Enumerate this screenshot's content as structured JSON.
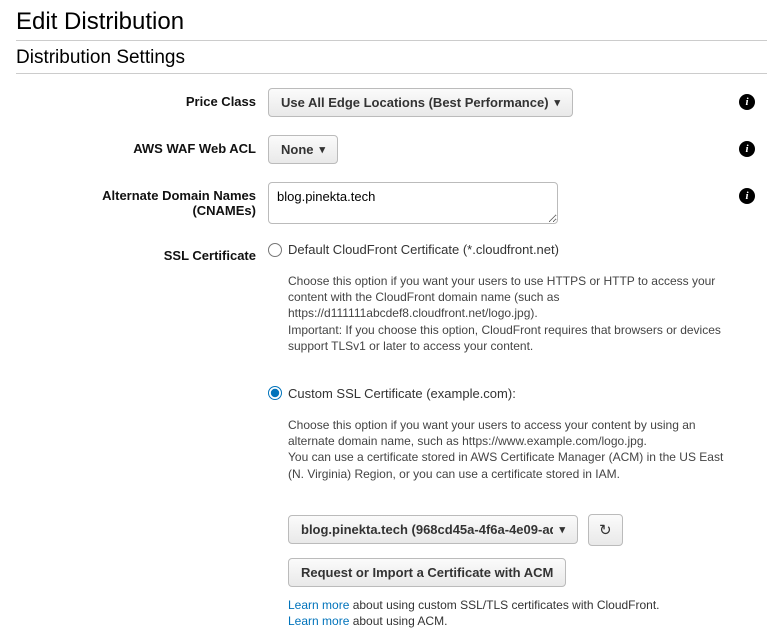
{
  "page": {
    "title": "Edit Distribution",
    "section_heading": "Distribution Settings"
  },
  "labels": {
    "price_class": "Price Class",
    "waf": "AWS WAF Web ACL",
    "cnames_line1": "Alternate Domain Names",
    "cnames_line2": "(CNAMEs)",
    "ssl": "SSL Certificate"
  },
  "price_class": {
    "selected": "Use All Edge Locations (Best Performance)"
  },
  "waf": {
    "selected": "None"
  },
  "cnames": {
    "value": "blog.pinekta.tech"
  },
  "ssl": {
    "default": {
      "label": "Default CloudFront Certificate (*.cloudfront.net)",
      "help": "Choose this option if you want your users to use HTTPS or HTTP to access your content with the CloudFront domain name (such as https://d111111abcdef8.cloudfront.net/logo.jpg).\nImportant: If you choose this option, CloudFront requires that browsers or devices support TLSv1 or later to access your content."
    },
    "custom": {
      "label": "Custom SSL Certificate (example.com):",
      "help": "Choose this option if you want your users to access your content by using an alternate domain name, such as https://www.example.com/logo.jpg.\nYou can use a certificate stored in AWS Certificate Manager (ACM) in the US East (N. Virginia) Region, or you can use a certificate stored in IAM.",
      "selected_cert": "blog.pinekta.tech (968cd45a-4f6a-4e09-ad...",
      "request_button": "Request or Import a Certificate with ACM",
      "learn1_link": "Learn more",
      "learn1_rest": " about using custom SSL/TLS certificates with CloudFront.",
      "learn2_link": "Learn more",
      "learn2_rest": " about using ACM."
    }
  },
  "icons": {
    "info": "i",
    "chevron_down": "▾",
    "refresh": "↻"
  }
}
